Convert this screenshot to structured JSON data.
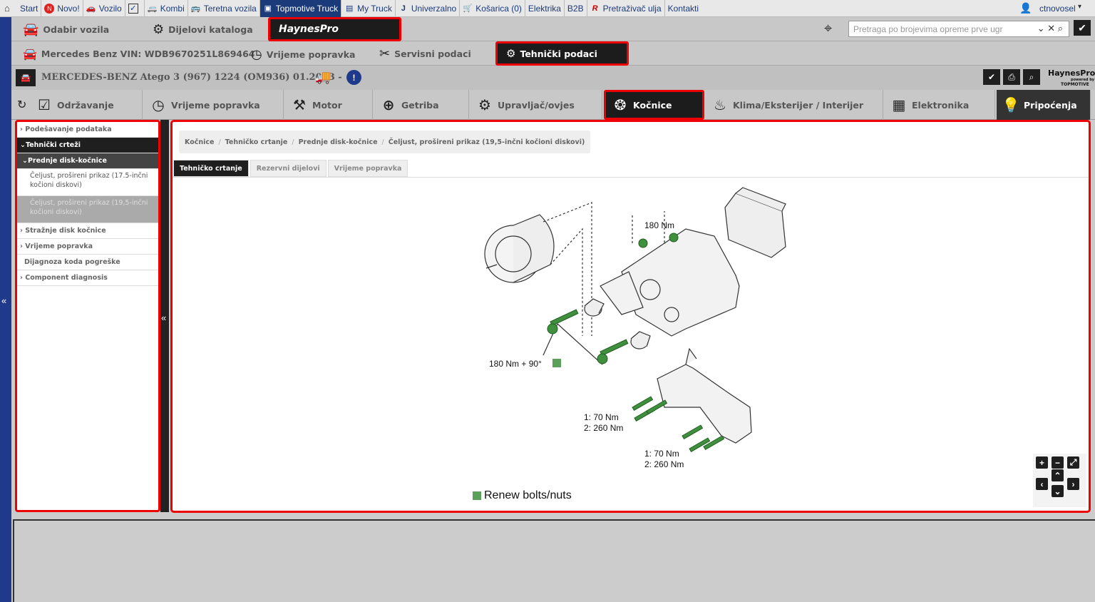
{
  "topbar": {
    "items": [
      {
        "label": "Start",
        "icon": "home-icon"
      },
      {
        "label": "Novo!",
        "icon": "new-icon"
      },
      {
        "label": "Vozilo",
        "icon": "car-icon"
      },
      {
        "label": "",
        "icon": "checkbox-icon"
      },
      {
        "label": "Kombi",
        "icon": "van-icon"
      },
      {
        "label": "Teretna vozila",
        "icon": "bus-icon"
      },
      {
        "label": "Topmotive Truck",
        "icon": "truck-icon"
      },
      {
        "label": "My Truck",
        "icon": "my-truck-icon"
      },
      {
        "label": "Univerzalno",
        "icon": "universal-icon"
      },
      {
        "label": "Košarica (0)",
        "icon": "cart-icon"
      },
      {
        "label": "Elektrika",
        "icon": ""
      },
      {
        "label": "B2B",
        "icon": ""
      },
      {
        "label": "Pretraživač ulja",
        "icon": "oil-icon"
      },
      {
        "label": "Kontakti",
        "icon": ""
      }
    ],
    "user": "ctnovosel"
  },
  "row2": {
    "vehicle_select": "Odabir vozila",
    "catalog_parts": "Dijelovi kataloga",
    "haynes_logo": "HaynesPro",
    "search_placeholder": "Pretraga po brojevima opreme prve ugr"
  },
  "row3": {
    "vin": "Mercedes Benz VIN: WDB9670251L869464",
    "repair_time": "Vrijeme popravka",
    "service_data": "Servisni podaci",
    "technical_data": "Tehnički podaci"
  },
  "row4": {
    "vehicle_title": "MERCEDES-BENZ Atego 3 (967) 1224 (OM936) 01.2013 -",
    "brand": "HaynesPro",
    "brand_sub": "powered by",
    "brand_sub2": "TOPMOTIVE"
  },
  "categories": [
    {
      "label": "Održavanje",
      "icon": "checklist-icon"
    },
    {
      "label": "Vrijeme popravka",
      "icon": "clock-icon"
    },
    {
      "label": "Motor",
      "icon": "piston-icon"
    },
    {
      "label": "Getriba",
      "icon": "gearbox-icon"
    },
    {
      "label": "Upravljač/ovjes",
      "icon": "suspension-icon"
    },
    {
      "label": "Kočnice",
      "icon": "brake-disc-icon"
    },
    {
      "label": "Klima/Eksterijer / Interijer",
      "icon": "seat-icon"
    },
    {
      "label": "Elektronika",
      "icon": "chip-icon"
    },
    {
      "label": "Pripoćenja",
      "icon": "lightbulb-icon"
    }
  ],
  "sidebar": {
    "items": [
      {
        "label": "Podešavanje podataka"
      },
      {
        "label": "Tehnički crteži"
      },
      {
        "label": "Prednje disk-kočnice"
      },
      {
        "label": "Čeljust, prošireni prikaz (17.5-inčni kočioni diskovi)"
      },
      {
        "label": "Čeljust, prošireni prikaz (19,5-inčni kočioni diskovi)"
      },
      {
        "label": "Stražnje disk kočnice"
      },
      {
        "label": "Vrijeme popravka"
      },
      {
        "label": "Dijagnoza koda pogreške"
      },
      {
        "label": "Component diagnosis"
      }
    ]
  },
  "breadcrumb": [
    "Kočnice",
    "Tehničko crtanje",
    "Prednje disk-kočnice",
    "Čeljust, prošireni prikaz (19,5-inčni kočioni diskovi)"
  ],
  "tabs": [
    "Tehničko crtanje",
    "Rezervni dijelovi",
    "Vrijeme popravka"
  ],
  "drawing": {
    "torque_top": "180 Nm",
    "torque_left": "180 Nm + 90°",
    "torque_mid_1": "1: 70 Nm",
    "torque_mid_2": "2: 260 Nm",
    "torque_low_1": "1: 70 Nm",
    "torque_low_2": "2: 260 Nm",
    "legend": "Renew bolts/nuts"
  },
  "colors": {
    "accent_red": "#ee0000",
    "bolt_green": "#3f8f3f",
    "nav_blue": "#1f3a8a"
  }
}
